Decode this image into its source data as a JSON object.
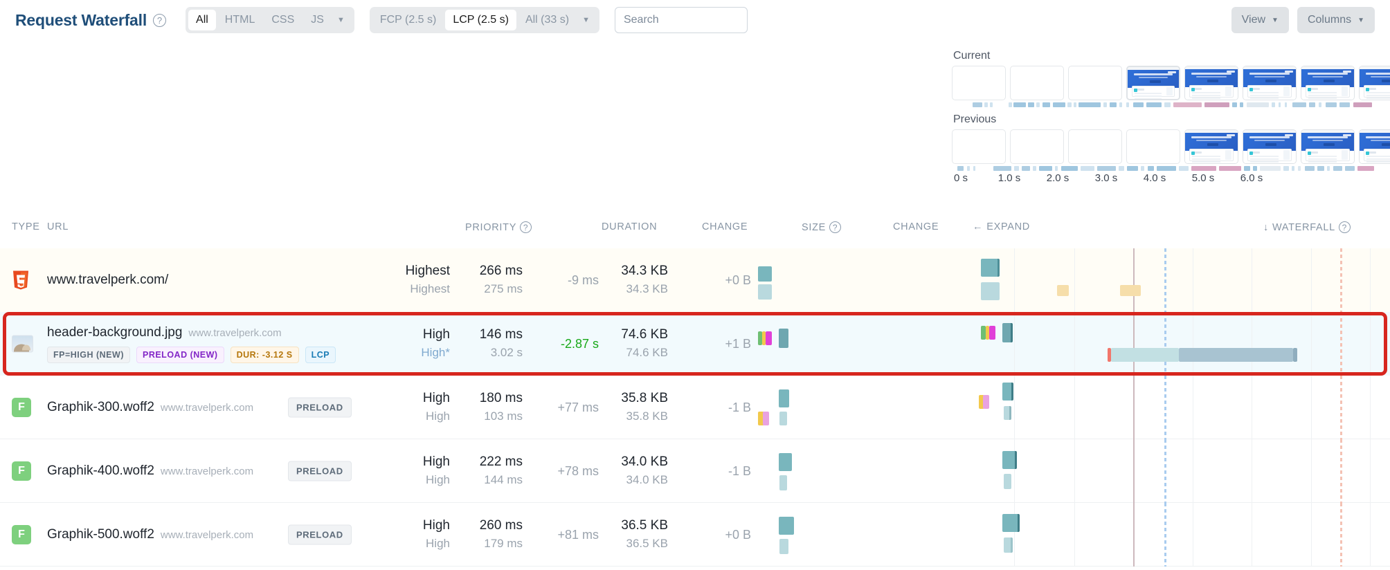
{
  "header": {
    "title": "Request Waterfall",
    "help_icon": "question-mark-icon",
    "type_filter": {
      "items": [
        {
          "label": "All",
          "active": true
        },
        {
          "label": "HTML",
          "active": false
        },
        {
          "label": "CSS",
          "active": false
        },
        {
          "label": "JS",
          "active": false
        }
      ],
      "caret": "▼"
    },
    "metric_filter": {
      "items": [
        {
          "label": "FCP (2.5 s)",
          "active": false
        },
        {
          "label": "LCP (2.5 s)",
          "active": true
        },
        {
          "label": "All (33 s)",
          "active": false
        }
      ],
      "caret": "▼"
    },
    "search": {
      "placeholder": "Search",
      "value": ""
    },
    "view_button": {
      "label": "View",
      "caret": "▼"
    },
    "columns_button": {
      "label": "Columns",
      "caret": "▼"
    }
  },
  "filmstrip": {
    "current_label": "Current",
    "previous_label": "Previous",
    "current_frames": [
      {
        "rendered": false,
        "selected": false
      },
      {
        "rendered": false,
        "selected": false
      },
      {
        "rendered": false,
        "selected": false
      },
      {
        "rendered": true,
        "selected": true
      },
      {
        "rendered": true,
        "selected": false
      },
      {
        "rendered": true,
        "selected": false
      },
      {
        "rendered": true,
        "selected": false
      },
      {
        "rendered": true,
        "selected": false
      },
      {
        "rendered": true,
        "selected": false
      }
    ],
    "previous_frames": [
      {
        "rendered": false,
        "selected": false
      },
      {
        "rendered": false,
        "selected": false
      },
      {
        "rendered": false,
        "selected": false
      },
      {
        "rendered": false,
        "selected": false
      },
      {
        "rendered": true,
        "selected": false
      },
      {
        "rendered": true,
        "selected": false
      },
      {
        "rendered": true,
        "selected": false
      },
      {
        "rendered": true,
        "selected": false
      },
      {
        "rendered": true,
        "selected": true
      }
    ],
    "axis_ticks": [
      "0 s",
      "1.0 s",
      "2.0 s",
      "3.0 s",
      "4.0 s",
      "5.0 s",
      "6.0 s"
    ]
  },
  "table": {
    "columns": [
      {
        "label": "TYPE",
        "help": false
      },
      {
        "label": "URL",
        "help": false
      },
      {
        "label": "PRIORITY",
        "help": true
      },
      {
        "label": "DURATION",
        "help": false
      },
      {
        "label": "CHANGE",
        "help": false
      },
      {
        "label": "SIZE",
        "help": true
      },
      {
        "label": "CHANGE",
        "help": false
      },
      {
        "label": "EXPAND",
        "help": false,
        "arrow": "←"
      },
      {
        "label": "WATERFALL",
        "help": true,
        "arrow": "↓"
      }
    ],
    "rows": [
      {
        "type_icon": "html5-icon",
        "url": "www.travelperk.com/",
        "host": "",
        "badges": [],
        "preload_pill": "",
        "priority": "Highest",
        "priority_prev": "Highest",
        "duration": "266 ms",
        "duration_prev": "275 ms",
        "duration_change": "-9 ms",
        "duration_change_state": "neutral",
        "size": "34.3 KB",
        "size_prev": "34.3 KB",
        "size_change": "+0 B",
        "highlighted": false,
        "tint": "cream"
      },
      {
        "type_icon": "image-thumbnail-icon",
        "url": "header-background.jpg",
        "host": "www.travelperk.com",
        "badges": [
          {
            "text": "FP=HIGH (NEW)",
            "style": "grey"
          },
          {
            "text": "PRELOAD (NEW)",
            "style": "purple"
          },
          {
            "text": "DUR: -3.12 S",
            "style": "orange"
          },
          {
            "text": "LCP",
            "style": "blue"
          }
        ],
        "preload_pill": "",
        "priority": "High",
        "priority_prev": "High*",
        "duration": "146 ms",
        "duration_prev": "3.02 s",
        "duration_change": "-2.87 s",
        "duration_change_state": "good",
        "size": "74.6 KB",
        "size_prev": "74.6 KB",
        "size_change": "+1 B",
        "highlighted": true,
        "tint": "blue"
      },
      {
        "type_icon": "font-file-icon",
        "url": "Graphik-300.woff2",
        "host": "www.travelperk.com",
        "badges": [],
        "preload_pill": "PRELOAD",
        "priority": "High",
        "priority_prev": "High",
        "duration": "180 ms",
        "duration_prev": "103 ms",
        "duration_change": "+77 ms",
        "duration_change_state": "neutral",
        "size": "35.8 KB",
        "size_prev": "35.8 KB",
        "size_change": "-1 B",
        "highlighted": false,
        "tint": "white"
      },
      {
        "type_icon": "font-file-icon",
        "url": "Graphik-400.woff2",
        "host": "www.travelperk.com",
        "badges": [],
        "preload_pill": "PRELOAD",
        "priority": "High",
        "priority_prev": "High",
        "duration": "222 ms",
        "duration_prev": "144 ms",
        "duration_change": "+78 ms",
        "duration_change_state": "neutral",
        "size": "34.0 KB",
        "size_prev": "34.0 KB",
        "size_change": "-1 B",
        "highlighted": false,
        "tint": "white"
      },
      {
        "type_icon": "font-file-icon",
        "url": "Graphik-500.woff2",
        "host": "www.travelperk.com",
        "badges": [],
        "preload_pill": "PRELOAD",
        "priority": "High",
        "priority_prev": "High",
        "duration": "260 ms",
        "duration_prev": "179 ms",
        "duration_change": "+81 ms",
        "duration_change_state": "neutral",
        "size": "36.5 KB",
        "size_prev": "36.5 KB",
        "size_change": "+0 B",
        "highlighted": false,
        "tint": "white"
      }
    ]
  },
  "colors": {
    "brand_title": "#1f4e79",
    "highlight_border": "#d7261e",
    "improvement_green": "#18a818",
    "teal_bar": "#79b6bd",
    "teal_bar_light": "#b9d9de",
    "cream_row": "#fffdf6",
    "blue_row": "#f2fafd"
  }
}
